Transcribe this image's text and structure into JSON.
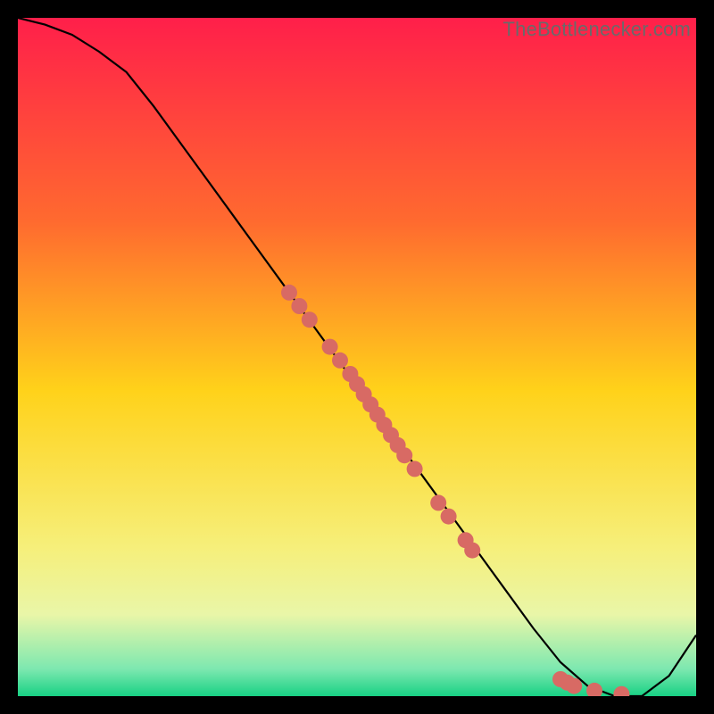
{
  "watermark": "TheBottlenecker.com",
  "chart_data": {
    "type": "line",
    "title": "",
    "xlabel": "",
    "ylabel": "",
    "xlim": [
      0,
      100
    ],
    "ylim": [
      0,
      100
    ],
    "background_gradient": {
      "stops": [
        {
          "pos": 0.0,
          "color": "#ff1f4a"
        },
        {
          "pos": 0.3,
          "color": "#ff6a2f"
        },
        {
          "pos": 0.55,
          "color": "#ffd21a"
        },
        {
          "pos": 0.78,
          "color": "#f6ef7a"
        },
        {
          "pos": 0.88,
          "color": "#e9f6a8"
        },
        {
          "pos": 0.96,
          "color": "#7de8b0"
        },
        {
          "pos": 1.0,
          "color": "#18d184"
        }
      ]
    },
    "series": [
      {
        "name": "bottleneck-curve",
        "x": [
          0,
          4,
          8,
          12,
          16,
          20,
          24,
          28,
          32,
          36,
          40,
          44,
          48,
          52,
          56,
          60,
          64,
          68,
          72,
          76,
          80,
          84,
          88,
          92,
          96,
          100
        ],
        "y": [
          100,
          99,
          97.5,
          95,
          92,
          87,
          81.5,
          76,
          70.5,
          65,
          59.5,
          54,
          48.5,
          43,
          37.5,
          32,
          26.5,
          21,
          15.5,
          10,
          5,
          1.5,
          0,
          0,
          3,
          9
        ]
      }
    ],
    "points": {
      "name": "highlighted-samples",
      "color": "#d86a64",
      "radius": 9,
      "xy": [
        [
          40.0,
          59.5
        ],
        [
          41.5,
          57.5
        ],
        [
          43.0,
          55.5
        ],
        [
          46.0,
          51.5
        ],
        [
          47.5,
          49.5
        ],
        [
          49.0,
          47.5
        ],
        [
          50.0,
          46.0
        ],
        [
          51.0,
          44.5
        ],
        [
          52.0,
          43.0
        ],
        [
          53.0,
          41.5
        ],
        [
          54.0,
          40.0
        ],
        [
          55.0,
          38.5
        ],
        [
          56.0,
          37.0
        ],
        [
          57.0,
          35.5
        ],
        [
          58.5,
          33.5
        ],
        [
          62.0,
          28.5
        ],
        [
          63.5,
          26.5
        ],
        [
          66.0,
          23.0
        ],
        [
          67.0,
          21.5
        ],
        [
          80.0,
          2.5
        ],
        [
          81.0,
          2.0
        ],
        [
          82.0,
          1.5
        ],
        [
          85.0,
          0.8
        ],
        [
          89.0,
          0.3
        ]
      ]
    }
  }
}
